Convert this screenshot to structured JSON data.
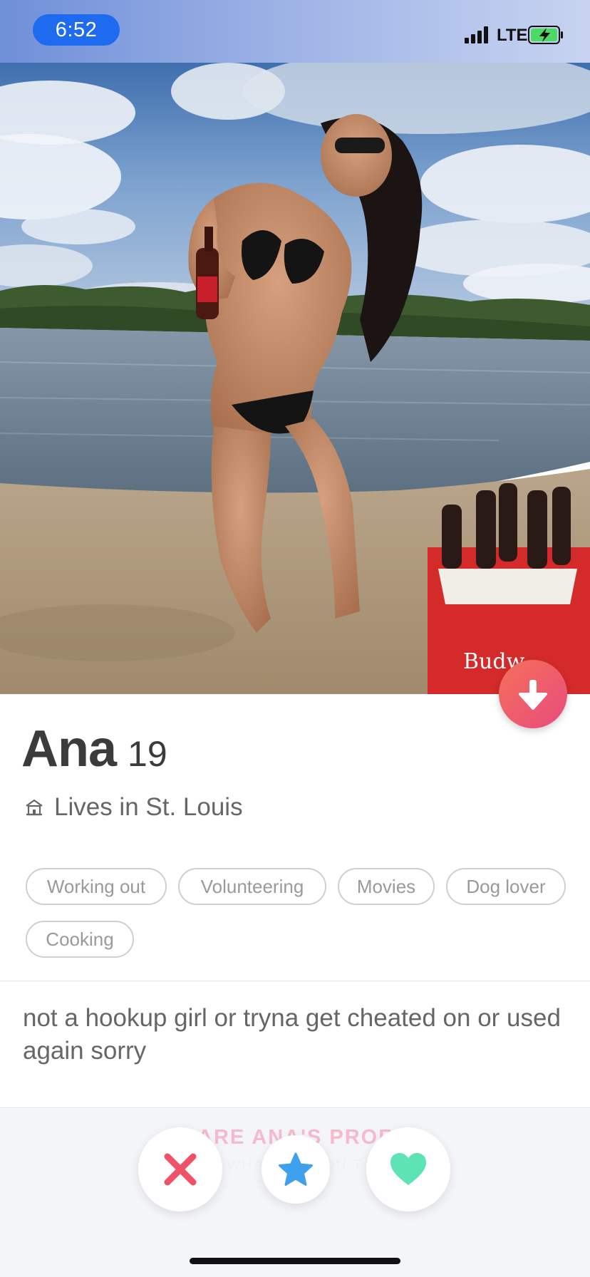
{
  "status_bar": {
    "time": "6:52",
    "network": "LTE",
    "signal_icon": "signal-bars-icon",
    "battery_icon": "battery-charging-icon",
    "battery_color": "#4cd964"
  },
  "photo": {
    "description_icon": "profile-photo"
  },
  "profile": {
    "name": "Ana",
    "age": "19",
    "location_icon": "home-icon",
    "location": "Lives in St. Louis",
    "interests": [
      "Working out",
      "Volunteering",
      "Movies",
      "Dog lover",
      "Cooking"
    ],
    "bio": "not a hookup girl or tryna get cheated on or used again sorry"
  },
  "footer": {
    "share_label": "ARE ANA'S PROF",
    "share_sub": "WHAT DID YOU T"
  },
  "actions": {
    "collapse_icon": "arrow-down-icon",
    "nope_icon": "close-icon",
    "super_like_icon": "star-icon",
    "like_icon": "heart-icon",
    "colors": {
      "brand_gradient_start": "#f4705a",
      "brand_gradient_end": "#e94b7d",
      "nope": "#ef5169",
      "super_like": "#3fa0ee",
      "like": "#5ee3b4"
    }
  }
}
